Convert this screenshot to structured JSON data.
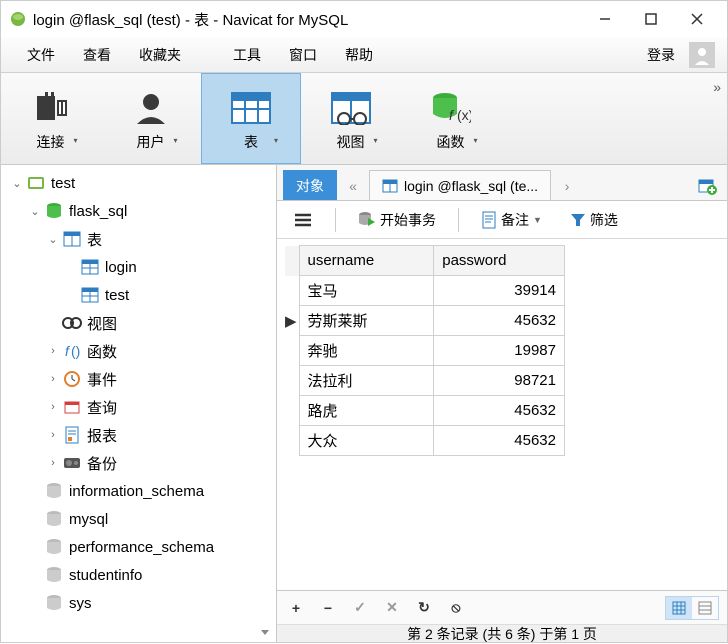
{
  "window": {
    "title": "login @flask_sql (test) - 表 - Navicat for MySQL"
  },
  "menu": {
    "items": [
      "文件",
      "查看",
      "收藏夹",
      "工具",
      "窗口",
      "帮助"
    ],
    "login": "登录"
  },
  "toolbar": {
    "items": [
      {
        "label": "连接",
        "icon": "plug"
      },
      {
        "label": "用户",
        "icon": "user"
      },
      {
        "label": "表",
        "icon": "table",
        "active": true
      },
      {
        "label": "视图",
        "icon": "view"
      },
      {
        "label": "函数",
        "icon": "fx"
      }
    ]
  },
  "tree": {
    "root": {
      "label": "test",
      "icon": "connection",
      "expanded": true
    },
    "db": {
      "label": "flask_sql",
      "icon": "database",
      "expanded": true
    },
    "cat_tables": {
      "label": "表",
      "icon": "tablecat",
      "expanded": true
    },
    "tables": [
      "login",
      "test"
    ],
    "cats": [
      {
        "label": "视图",
        "icon": "view-infinity"
      },
      {
        "label": "函数",
        "icon": "fx-small"
      },
      {
        "label": "事件",
        "icon": "clock"
      },
      {
        "label": "查询",
        "icon": "query"
      },
      {
        "label": "报表",
        "icon": "report"
      },
      {
        "label": "备份",
        "icon": "backup"
      }
    ],
    "other_dbs": [
      "information_schema",
      "mysql",
      "performance_schema",
      "studentinfo",
      "sys"
    ]
  },
  "tabs": {
    "objects": "对象",
    "open": "login @flask_sql (te..."
  },
  "subtoolbar": {
    "menu": "menu-icon",
    "begin_tx": "开始事务",
    "memo": "备注",
    "filter": "筛选"
  },
  "grid": {
    "columns": [
      "username",
      "password"
    ],
    "rows": [
      {
        "username": "宝马",
        "password": "39914"
      },
      {
        "username": "劳斯莱斯",
        "password": "45632",
        "current": true
      },
      {
        "username": "奔驰",
        "password": "19987"
      },
      {
        "username": "法拉利",
        "password": "98721"
      },
      {
        "username": "路虎",
        "password": "45632"
      },
      {
        "username": "大众",
        "password": "45632"
      }
    ]
  },
  "status": {
    "text": "第 2 条记录 (共 6 条) 于第 1 页"
  }
}
